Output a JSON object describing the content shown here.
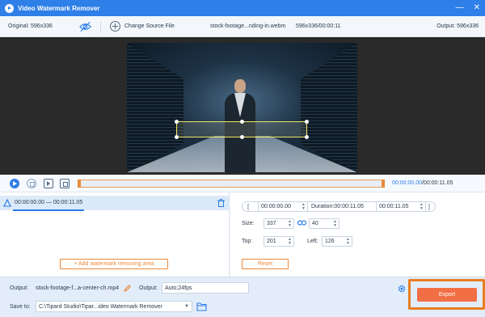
{
  "titlebar": {
    "title": "Video Watermark Remover",
    "minimize_glyph": "—",
    "close_glyph": "✕"
  },
  "infobar": {
    "original": "Original: 596x336",
    "change_source": "Change Source File",
    "filename": "stock-footage...nding-in.webm",
    "fileinfo": "596x336/00:00:11",
    "output": "Output: 596x336"
  },
  "playbar": {
    "current": "00:00:00.00",
    "total": "/00:00:11.05"
  },
  "segment": {
    "range": "00:00:00.00  —  00:00:11.05"
  },
  "left_panel": {
    "add_button": "Add watermark removing area",
    "add_plus": "+"
  },
  "right_panel": {
    "start_time": "00:00:00.00",
    "duration": "Duration:00:00:11.05",
    "end_time": "00:00:11.05",
    "size_label": "Size:",
    "width": "337",
    "height": "40",
    "top_label": "Top:",
    "top": "201",
    "left_label": "Left:",
    "left": "126",
    "reset": "Reset",
    "bracket_left": "[",
    "bracket_right": "]"
  },
  "bottom": {
    "output_label": "Output:",
    "output_file": "stock-footage-f...a-center-ch.mp4",
    "format_label": "Output:",
    "format": "Auto;24fps",
    "save_label": "Save to:",
    "save_path": "C:\\Tipard Studio\\Tipar...ideo Watermark Remover",
    "dropdown_glyph": "▼"
  },
  "export": {
    "label": "Export"
  },
  "colors": {
    "accent": "#2e7fe8",
    "orange": "#ec8a3a",
    "export_bg": "#f26f45"
  },
  "icons": [
    "app-logo-icon",
    "eye-slash-icon",
    "add-circle-icon",
    "play-icon",
    "stop-icon",
    "next-frame-icon",
    "clip-icon",
    "segment-icon",
    "trash-icon",
    "link-icon",
    "pencil-icon",
    "gear-icon",
    "folder-icon"
  ]
}
